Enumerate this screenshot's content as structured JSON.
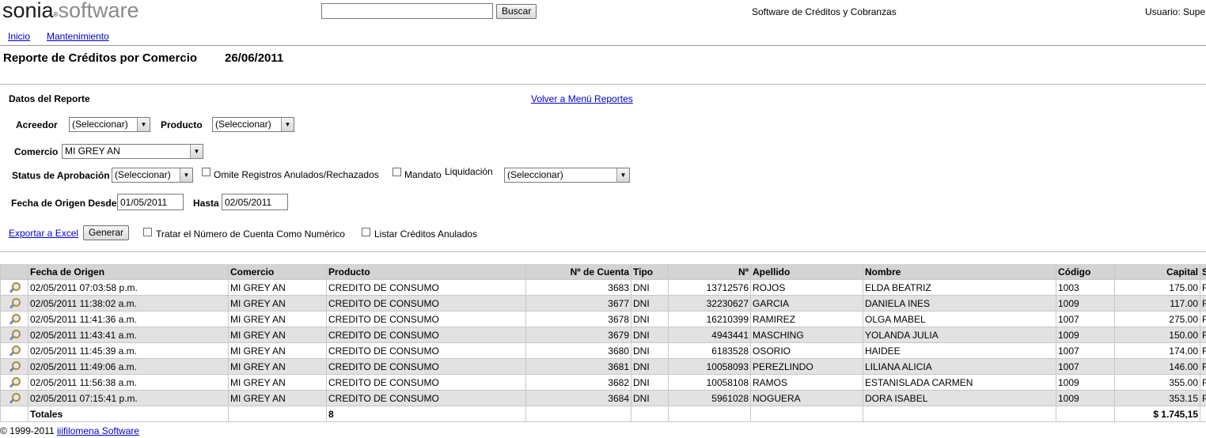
{
  "header": {
    "logo_part1": "sonia",
    "logo_reg": "®",
    "logo_part2": "software",
    "search_value": "",
    "search_button": "Buscar",
    "app_title": "Software de Créditos y Cobranzas",
    "user_label": "Usuario: Supe"
  },
  "nav": {
    "inicio": "Inicio",
    "mantenimiento": "Mantenimiento"
  },
  "page": {
    "title": "Reporte de Créditos por Comercio",
    "date": "26/06/2011"
  },
  "form": {
    "section_title": "Datos del Reporte",
    "back_link": "Volver a Menú Reportes",
    "acreedor_label": "Acreedor",
    "acreedor_value": "(Seleccionar)",
    "producto_label": "Producto",
    "producto_value": "(Seleccionar)",
    "comercio_label": "Comercio",
    "comercio_value": "MI GREY AN",
    "status_label": "Status de Aprobación",
    "status_value": "(Seleccionar)",
    "omite_label": "Omite Registros Anulados/Rechazados",
    "mandato_label": "Mandato",
    "liquidacion_label": "Liquidación",
    "liquidacion_value": "(Seleccionar)",
    "fecha_desde_label": "Fecha de Origen Desde",
    "fecha_desde_value": "01/05/2011",
    "hasta_label": "Hasta",
    "hasta_value": "02/05/2011",
    "export_link": "Exportar a Excel",
    "generar_button": "Generar",
    "tratar_label": "Tratar el Número de Cuenta Como Numérico",
    "listar_label": "Listar Créditos Anulados"
  },
  "table": {
    "headers": [
      "Fecha de Origen",
      "Comercio",
      "Producto",
      "Nº de Cuenta",
      "Tipo",
      "Nº",
      "Apellido",
      "Nombre",
      "Código",
      "Capital",
      "S"
    ],
    "rows": [
      {
        "fecha": "02/05/2011 07:03:58 p.m.",
        "comercio": "MI GREY AN",
        "producto": "CREDITO DE CONSUMO",
        "cuenta": "3683",
        "tipo": "DNI",
        "nro": "13712576",
        "apellido": "ROJOS",
        "nombre": "ELDA BEATRIZ",
        "codigo": "1003",
        "capital": "175.00",
        "s": "F"
      },
      {
        "fecha": "02/05/2011 11:38:02 a.m.",
        "comercio": "MI GREY AN",
        "producto": "CREDITO DE CONSUMO",
        "cuenta": "3677",
        "tipo": "DNI",
        "nro": "32230627",
        "apellido": "GARCIA",
        "nombre": "DANIELA INES",
        "codigo": "1009",
        "capital": "117.00",
        "s": "F"
      },
      {
        "fecha": "02/05/2011 11:41:36 a.m.",
        "comercio": "MI GREY AN",
        "producto": "CREDITO DE CONSUMO",
        "cuenta": "3678",
        "tipo": "DNI",
        "nro": "16210399",
        "apellido": "RAMIREZ",
        "nombre": "OLGA MABEL",
        "codigo": "1007",
        "capital": "275.00",
        "s": "F"
      },
      {
        "fecha": "02/05/2011 11:43:41 a.m.",
        "comercio": "MI GREY AN",
        "producto": "CREDITO DE CONSUMO",
        "cuenta": "3679",
        "tipo": "DNI",
        "nro": "4943441",
        "apellido": "MASCHING",
        "nombre": "YOLANDA JULIA",
        "codigo": "1009",
        "capital": "150.00",
        "s": "F"
      },
      {
        "fecha": "02/05/2011 11:45:39 a.m.",
        "comercio": "MI GREY AN",
        "producto": "CREDITO DE CONSUMO",
        "cuenta": "3680",
        "tipo": "DNI",
        "nro": "6183528",
        "apellido": "OSORIO",
        "nombre": "HAIDEE",
        "codigo": "1007",
        "capital": "174.00",
        "s": "F"
      },
      {
        "fecha": "02/05/2011 11:49:06 a.m.",
        "comercio": "MI GREY AN",
        "producto": "CREDITO DE CONSUMO",
        "cuenta": "3681",
        "tipo": "DNI",
        "nro": "10058093",
        "apellido": "PEREZLINDO",
        "nombre": "LILIANA ALICIA",
        "codigo": "1007",
        "capital": "146.00",
        "s": "F"
      },
      {
        "fecha": "02/05/2011 11:56:38 a.m.",
        "comercio": "MI GREY AN",
        "producto": "CREDITO DE CONSUMO",
        "cuenta": "3682",
        "tipo": "DNI",
        "nro": "10058108",
        "apellido": "RAMOS",
        "nombre": "ESTANISLADA CARMEN",
        "codigo": "1009",
        "capital": "355.00",
        "s": "F"
      },
      {
        "fecha": "02/05/2011 07:15:41 p.m.",
        "comercio": "MI GREY AN",
        "producto": "CREDITO DE CONSUMO",
        "cuenta": "3684",
        "tipo": "DNI",
        "nro": "5961028",
        "apellido": "NOGUERA",
        "nombre": "DORA ISABEL",
        "codigo": "1009",
        "capital": "353.15",
        "s": "F"
      }
    ],
    "totals": {
      "label": "Totales",
      "count": "8",
      "capital": "$ 1.745,15"
    }
  },
  "footer": {
    "copyright": "© 1999-2011",
    "link": "iiifilomena Software"
  }
}
